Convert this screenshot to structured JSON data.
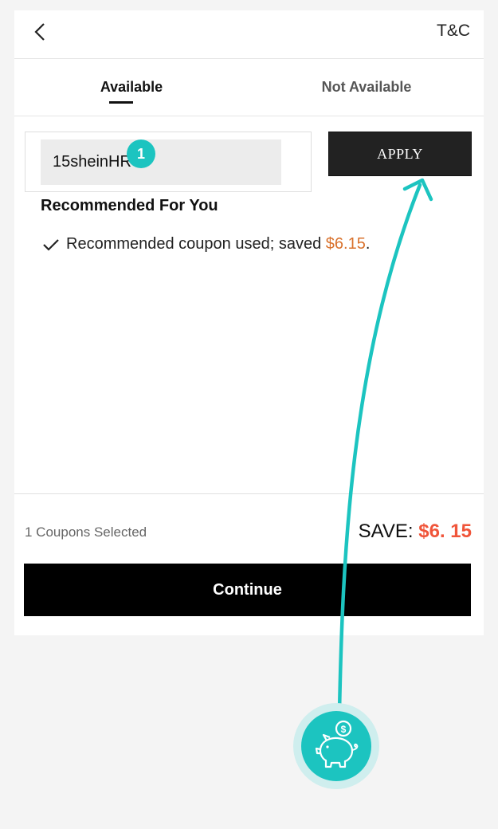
{
  "header": {
    "back_icon": "chevron-left-icon",
    "tc_label": "T&C"
  },
  "tabs": [
    {
      "label": "Available",
      "active": true
    },
    {
      "label": "Not Available",
      "active": false
    }
  ],
  "coupon": {
    "input_value": "15sheinHR",
    "step_number": "1",
    "apply_label": "APPLY"
  },
  "recommended": {
    "title": "Recommended For You",
    "message": "Recommended coupon used; saved ",
    "saved_amount": "$6.15",
    "trailing": ".",
    "check_icon": "checkmark-icon"
  },
  "footer": {
    "coupons_selected": "1 Coupons Selected",
    "save_label": "SAVE: ",
    "save_value": "$6. 15",
    "continue_label": "Continue"
  },
  "overlay": {
    "piggy_icon": "piggy-bank-icon",
    "accent_color": "#1cc4c0"
  },
  "colors": {
    "saved_amount": "#d9722d",
    "save_value": "#f0553a",
    "button_dark": "#222222"
  }
}
